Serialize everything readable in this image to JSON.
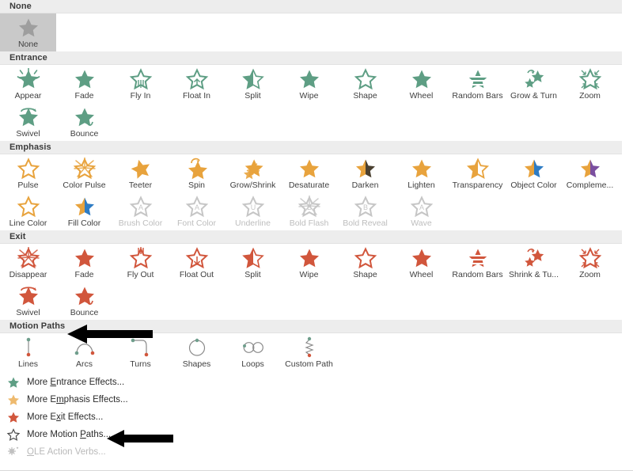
{
  "sections": [
    {
      "id": "none",
      "title": "None",
      "color": "#9e9e9e",
      "items": [
        {
          "label": "None",
          "icon": "star-plain",
          "selected": true,
          "disabled": false
        }
      ]
    },
    {
      "id": "entrance",
      "title": "Entrance",
      "color": "#5e9e84",
      "items": [
        {
          "label": "Appear",
          "icon": "star-burst",
          "disabled": false
        },
        {
          "label": "Fade",
          "icon": "star-solid",
          "disabled": false
        },
        {
          "label": "Fly In",
          "icon": "star-flyin",
          "disabled": false
        },
        {
          "label": "Float In",
          "icon": "star-floatin",
          "disabled": false
        },
        {
          "label": "Split",
          "icon": "star-split",
          "disabled": false
        },
        {
          "label": "Wipe",
          "icon": "star-wipe",
          "disabled": false
        },
        {
          "label": "Shape",
          "icon": "star-outline",
          "disabled": false
        },
        {
          "label": "Wheel",
          "icon": "star-wheel",
          "disabled": false
        },
        {
          "label": "Random Bars",
          "icon": "star-bars",
          "disabled": false
        },
        {
          "label": "Grow & Turn",
          "icon": "star-growturn",
          "disabled": false
        },
        {
          "label": "Zoom",
          "icon": "star-zoomin",
          "disabled": false
        },
        {
          "label": "Swivel",
          "icon": "star-swivel",
          "disabled": false
        },
        {
          "label": "Bounce",
          "icon": "star-bounce",
          "disabled": false
        }
      ]
    },
    {
      "id": "emphasis",
      "title": "Emphasis",
      "color": "#e8a33d",
      "items": [
        {
          "label": "Pulse",
          "icon": "star-outline",
          "disabled": false
        },
        {
          "label": "Color Pulse",
          "icon": "star-burstout",
          "disabled": false
        },
        {
          "label": "Teeter",
          "icon": "star-tilt",
          "disabled": false
        },
        {
          "label": "Spin",
          "icon": "star-spin",
          "disabled": false
        },
        {
          "label": "Grow/Shrink",
          "icon": "star-growshrink",
          "disabled": false
        },
        {
          "label": "Desaturate",
          "icon": "star-solid",
          "disabled": false
        },
        {
          "label": "Darken",
          "icon": "star-half-dark",
          "disabled": false
        },
        {
          "label": "Lighten",
          "icon": "star-solid",
          "disabled": false
        },
        {
          "label": "Transparency",
          "icon": "star-half-open",
          "disabled": false
        },
        {
          "label": "Object Color",
          "icon": "star-half-blue",
          "disabled": false
        },
        {
          "label": "Compleme...",
          "icon": "star-half-purple",
          "disabled": false
        },
        {
          "label": "Line Color",
          "icon": "star-outline",
          "disabled": false
        },
        {
          "label": "Fill Color",
          "icon": "star-half-blue",
          "disabled": false
        },
        {
          "label": "Brush Color",
          "icon": "star-letter-A",
          "disabled": true
        },
        {
          "label": "Font Color",
          "icon": "star-letter-A",
          "disabled": true
        },
        {
          "label": "Underline",
          "icon": "star-letter-U",
          "disabled": true
        },
        {
          "label": "Bold Flash",
          "icon": "star-letter-B-burst",
          "disabled": true
        },
        {
          "label": "Bold Reveal",
          "icon": "star-letter-B",
          "disabled": true
        },
        {
          "label": "Wave",
          "icon": "star-letter-A",
          "disabled": true
        }
      ]
    },
    {
      "id": "exit",
      "title": "Exit",
      "color": "#d1563c",
      "items": [
        {
          "label": "Disappear",
          "icon": "star-burstout",
          "disabled": false
        },
        {
          "label": "Fade",
          "icon": "star-solid",
          "disabled": false
        },
        {
          "label": "Fly Out",
          "icon": "star-flyout",
          "disabled": false
        },
        {
          "label": "Float Out",
          "icon": "star-floatout",
          "disabled": false
        },
        {
          "label": "Split",
          "icon": "star-split",
          "disabled": false
        },
        {
          "label": "Wipe",
          "icon": "star-wipe",
          "disabled": false
        },
        {
          "label": "Shape",
          "icon": "star-outline",
          "disabled": false
        },
        {
          "label": "Wheel",
          "icon": "star-wheel",
          "disabled": false
        },
        {
          "label": "Random Bars",
          "icon": "star-bars",
          "disabled": false
        },
        {
          "label": "Shrink & Tu...",
          "icon": "star-growturn",
          "disabled": false
        },
        {
          "label": "Zoom",
          "icon": "star-zoomin",
          "disabled": false
        },
        {
          "label": "Swivel",
          "icon": "star-swivel",
          "disabled": false
        },
        {
          "label": "Bounce",
          "icon": "star-bounce",
          "disabled": false
        }
      ]
    },
    {
      "id": "motion_paths",
      "title": "Motion Paths",
      "color": "#7a7a7a",
      "items": [
        {
          "label": "Lines",
          "icon": "path-line",
          "disabled": false
        },
        {
          "label": "Arcs",
          "icon": "path-arc",
          "disabled": false
        },
        {
          "label": "Turns",
          "icon": "path-turn",
          "disabled": false
        },
        {
          "label": "Shapes",
          "icon": "path-circle",
          "disabled": false
        },
        {
          "label": "Loops",
          "icon": "path-loop",
          "disabled": false
        },
        {
          "label": "Custom Path",
          "icon": "path-custom",
          "disabled": false
        }
      ]
    }
  ],
  "menu": {
    "items": [
      {
        "label": "More Entrance Effects...",
        "accel": "E",
        "icon": "star-green",
        "disabled": false
      },
      {
        "label": "More Emphasis Effects...",
        "accel": "m",
        "icon": "star-gold",
        "disabled": false
      },
      {
        "label": "More Exit Effects...",
        "accel": "x",
        "icon": "star-red",
        "disabled": false
      },
      {
        "label": "More Motion Paths...",
        "accel": "P",
        "icon": "star-hollow",
        "disabled": false
      },
      {
        "label": "OLE Action Verbs...",
        "accel": "O",
        "icon": "ole-gear",
        "disabled": true
      }
    ]
  },
  "annotations": [
    {
      "name": "arrow-motion-paths",
      "target": "Motion Paths"
    },
    {
      "name": "arrow-more-motion-paths",
      "target": "More Motion Paths..."
    }
  ],
  "colors": {
    "entrance": "#5e9e84",
    "emphasis": "#e8a33d",
    "exit": "#d1563c",
    "disabled": "#c6c6c6",
    "none": "#9e9e9e",
    "blue": "#2e7cc4",
    "purple": "#7b4fa0",
    "dark": "#4a4030",
    "header_bg": "#ededed",
    "selected_bg": "#c9c9c9",
    "path_start": "#6f9e8c",
    "path_end": "#d1563c"
  }
}
